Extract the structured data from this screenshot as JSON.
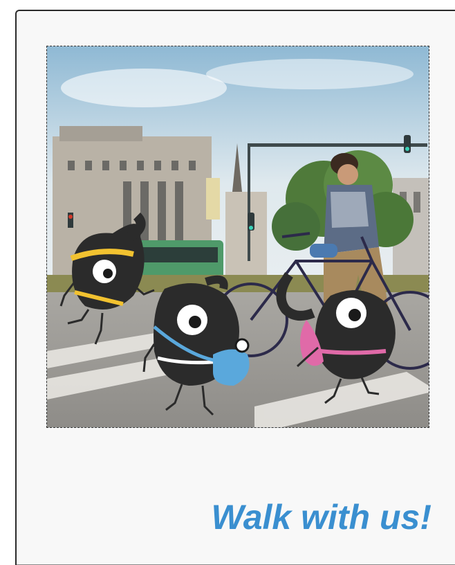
{
  "card": {
    "caption": "Walk with us!"
  },
  "colors": {
    "caption": "#3a8fd0",
    "card_background": "#f8f8f8",
    "mascot_body": "#2b2b2b",
    "headband_yellow": "#f2c230",
    "bag_blue": "#5aa8dc",
    "bag_pink": "#e06aa8"
  },
  "photo": {
    "description_icons": [
      "mascot-runner-icon",
      "mascot-photographer-icon",
      "mascot-walker-icon"
    ]
  }
}
